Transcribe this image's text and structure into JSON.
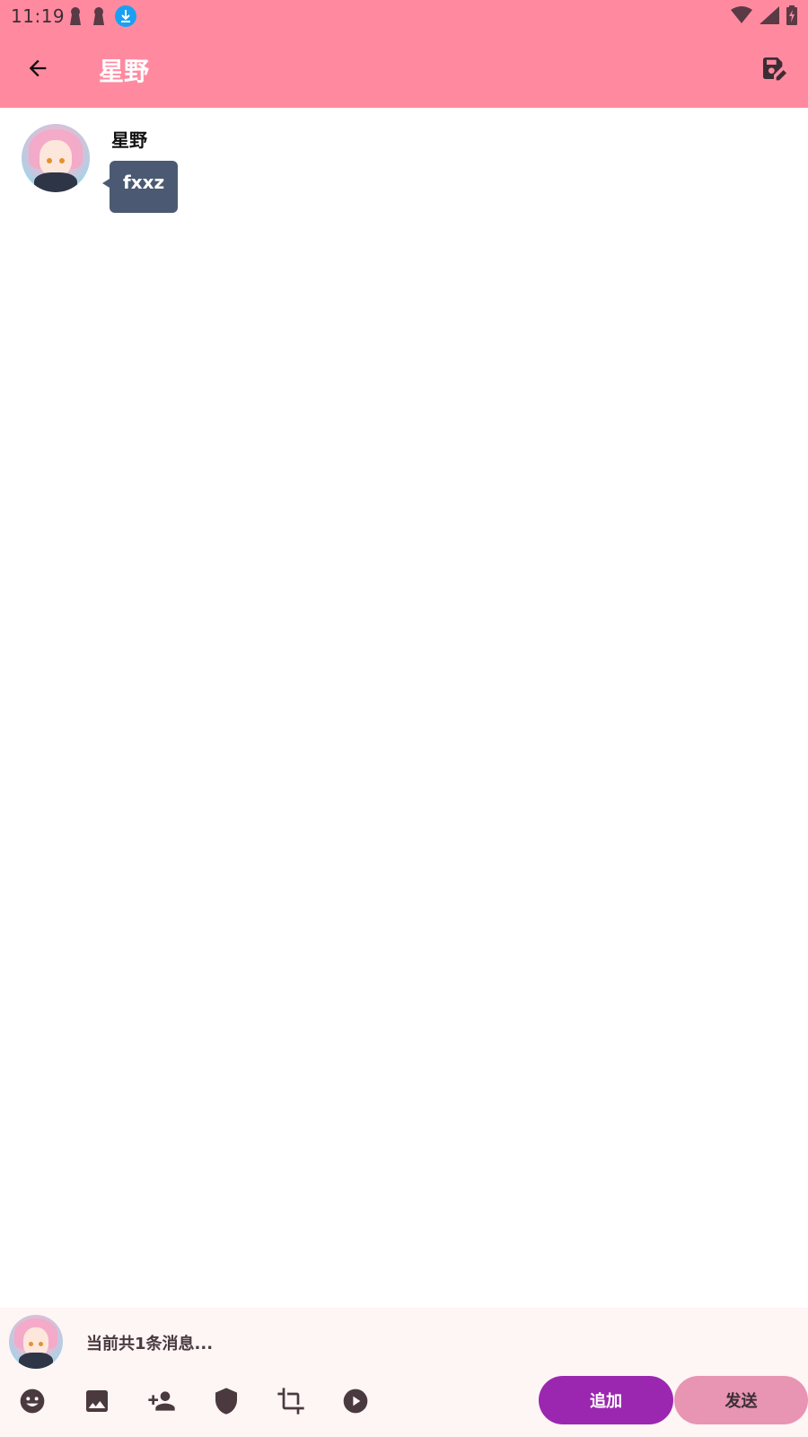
{
  "status_bar": {
    "time": "11:19",
    "icons_left": [
      "keyhole-icon",
      "keyhole-icon",
      "download-icon"
    ],
    "icons_right": [
      "wifi-icon",
      "signal-icon",
      "battery-charging-icon"
    ]
  },
  "app_bar": {
    "title": "星野",
    "back_icon": "arrow-back-icon",
    "action_icon": "save-edit-icon",
    "color": "#ff8aa0"
  },
  "messages": [
    {
      "sender": "星野",
      "text": "fxxz",
      "bubble_color": "#4b5a72"
    }
  ],
  "bottom": {
    "status_text": "当前共1条消息...",
    "tools": [
      "emoji-icon",
      "image-icon",
      "add-person-icon",
      "shield-icon",
      "crop-icon",
      "play-icon"
    ],
    "append_label": "追加",
    "send_label": "发送",
    "append_color": "#9b27b0",
    "send_color": "#e795b3"
  }
}
